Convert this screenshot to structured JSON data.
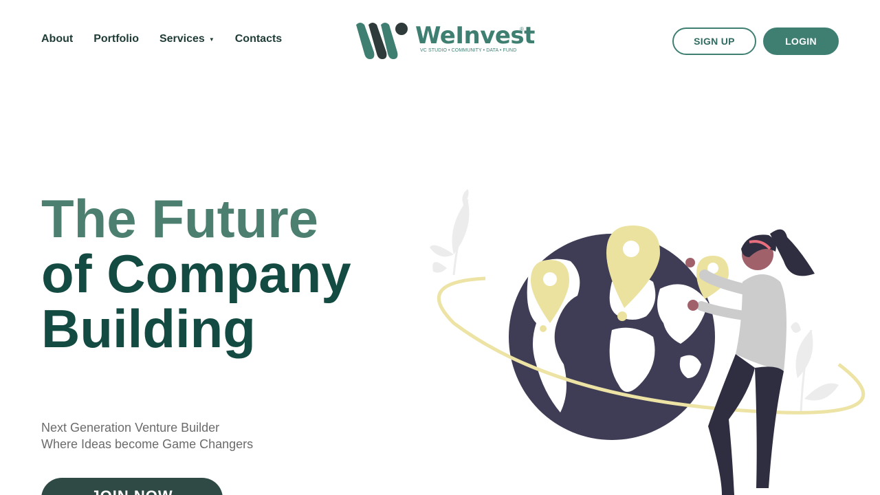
{
  "nav": {
    "items": [
      {
        "label": "About"
      },
      {
        "label": "Portfolio"
      },
      {
        "label": "Services"
      },
      {
        "label": "Contacts"
      }
    ]
  },
  "logo": {
    "name": "WeInvest",
    "registered": "®",
    "tagline": "VC STUDIO • COMMUNITY • DATA • FUND"
  },
  "auth": {
    "signup_label": "SIGN UP",
    "login_label": "LOGIN"
  },
  "hero": {
    "title_line1": "The Future",
    "title_line2": "of Company",
    "title_line3": "Building",
    "sub_line1": "Next Generation Venture Builder",
    "sub_line2": "Where Ideas become Game Changers",
    "cta_label": "JOIN NOW"
  },
  "colors": {
    "brand": "#3f7f72",
    "dark_green": "#134a42",
    "globe": "#3f3d56",
    "pin": "#ebe2a0"
  },
  "icons": [
    "chevron-down-icon",
    "map-pin-icon",
    "globe-icon"
  ]
}
